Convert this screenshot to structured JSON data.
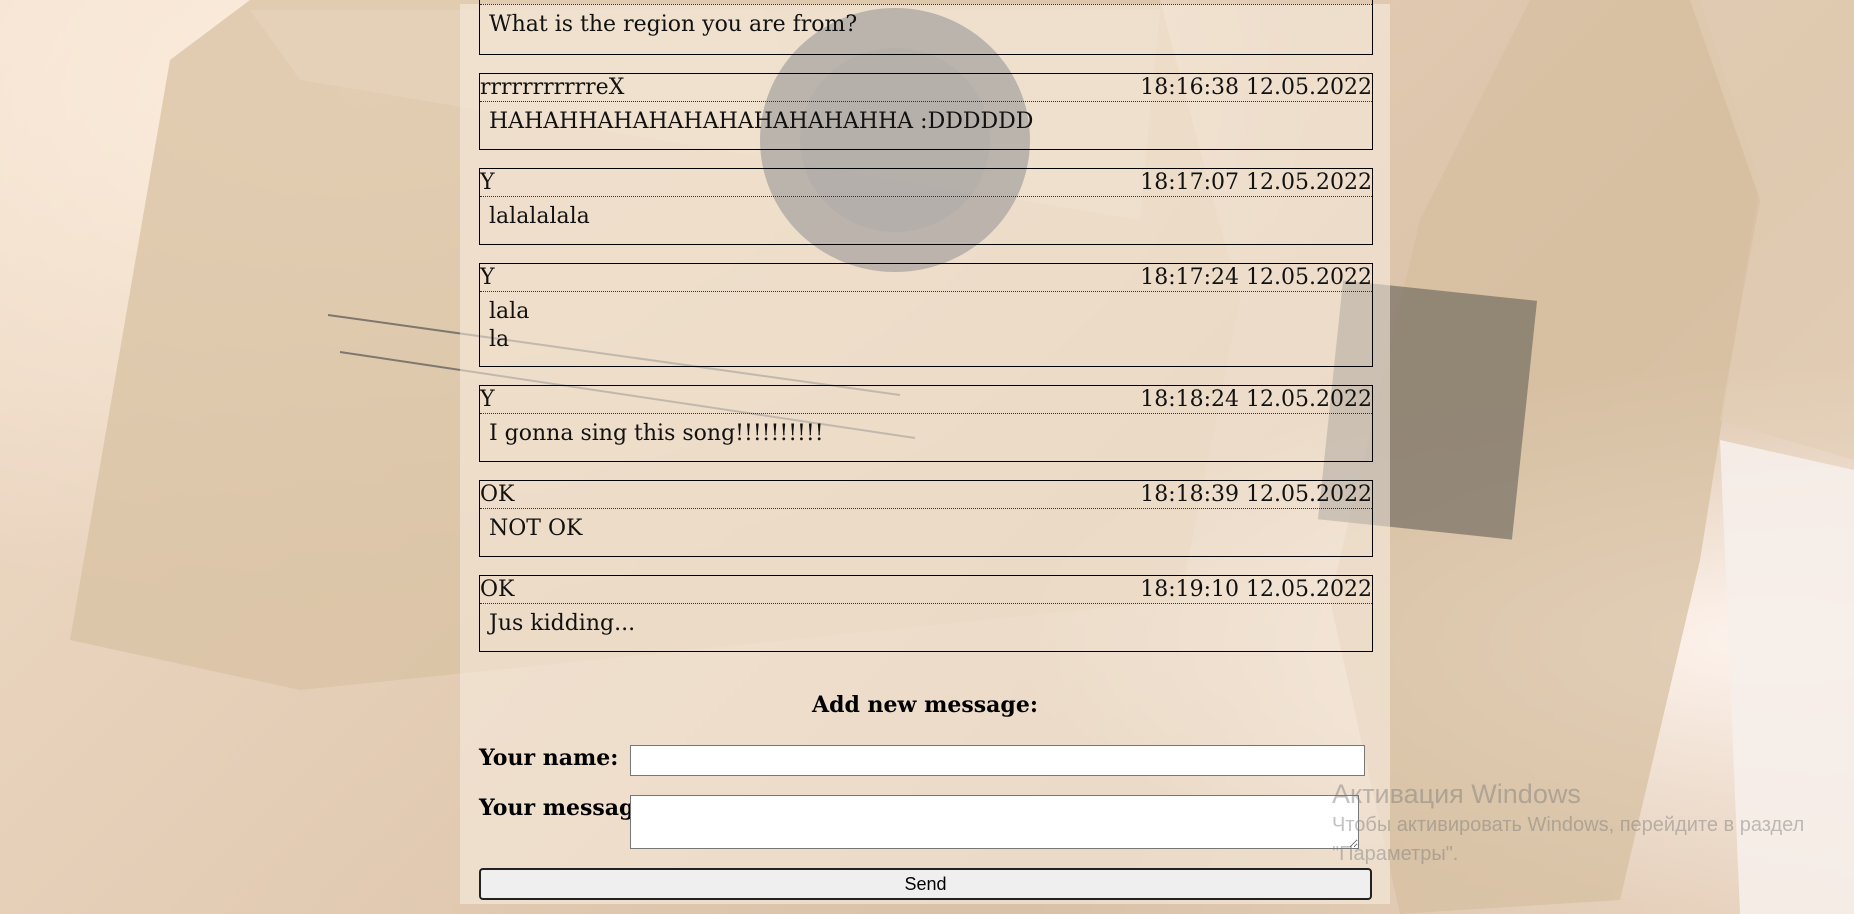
{
  "previous_message_partial": {
    "body": "What is the region you are from?"
  },
  "messages": [
    {
      "author": "rrrrrrrrrrreX",
      "time": "18:16:38 12.05.2022",
      "body": "HAHAHHAHAHAHAHAHAHAHAHHA :DDDDDD"
    },
    {
      "author": "Y",
      "time": "18:17:07 12.05.2022",
      "body": "lalalalala"
    },
    {
      "author": "Y",
      "time": "18:17:24 12.05.2022",
      "body": "lala\nla"
    },
    {
      "author": "Y",
      "time": "18:18:24 12.05.2022",
      "body": "I gonna sing this song!!!!!!!!!!"
    },
    {
      "author": "OK",
      "time": "18:18:39 12.05.2022",
      "body": "NOT OK"
    },
    {
      "author": "OK",
      "time": "18:19:10 12.05.2022",
      "body": "Jus kidding..."
    }
  ],
  "form": {
    "title": "Add new message:",
    "name_label": "Your name:",
    "name_value": "",
    "message_label": "Your message:",
    "message_value": "",
    "send_label": "Send"
  },
  "windows_activation": {
    "title": "Активация Windows",
    "text": "Чтобы активировать Windows, перейдите в раздел \"Параметры\"."
  }
}
